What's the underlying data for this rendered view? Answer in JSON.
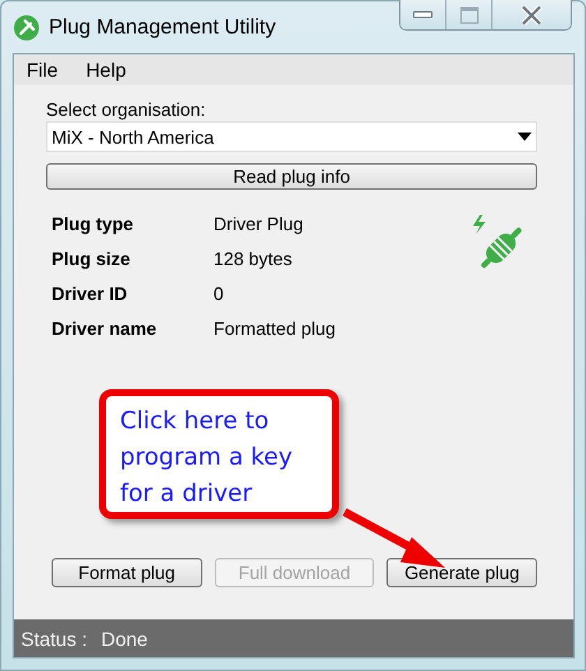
{
  "window": {
    "title": "Plug Management Utility"
  },
  "menu": [
    {
      "label": "File"
    },
    {
      "label": "Help"
    }
  ],
  "organisation": {
    "label": "Select organisation:",
    "value": "MiX - North America"
  },
  "read_button": {
    "label": "Read plug info"
  },
  "plug_info": [
    {
      "label": "Plug type",
      "value": "Driver Plug"
    },
    {
      "label": "Plug size",
      "value": "128 bytes"
    },
    {
      "label": "Driver ID",
      "value": "0"
    },
    {
      "label": "Driver name",
      "value": "Formatted plug"
    }
  ],
  "callout": {
    "text": "Click here to program a key for a driver"
  },
  "buttons": [
    {
      "label": "Format plug",
      "disabled": false
    },
    {
      "label": "Full download",
      "disabled": true
    },
    {
      "label": "Generate plug",
      "disabled": false
    }
  ],
  "status_bar": {
    "label": "Status :",
    "value": "Done"
  }
}
